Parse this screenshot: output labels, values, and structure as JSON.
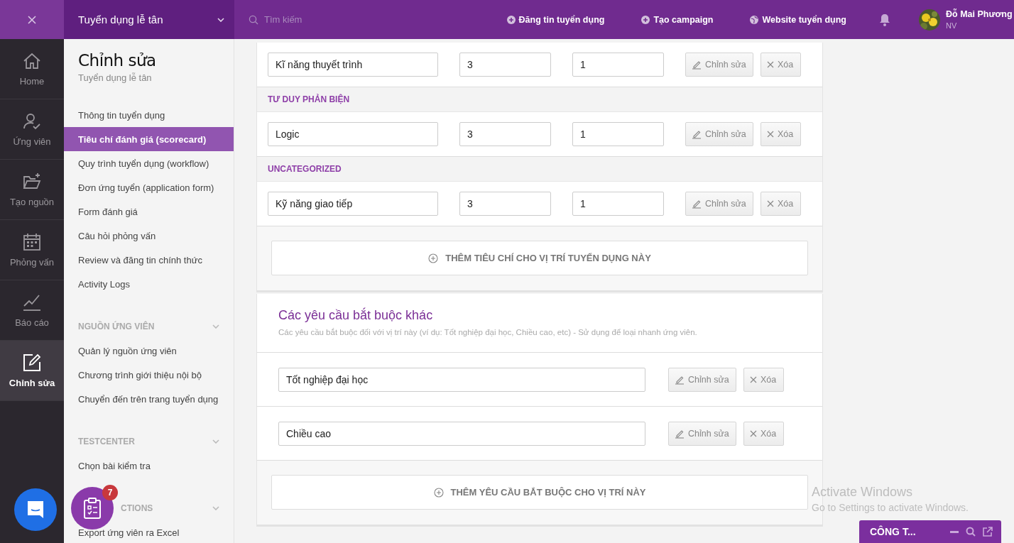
{
  "topbar": {
    "job_selector": "Tuyển dụng lễ tân",
    "search": {
      "placeholder": "Tìm kiếm"
    },
    "actions": [
      "Đăng tin tuyển dụng",
      "Tạo campaign",
      "Website tuyển dụng"
    ],
    "user": {
      "name": "Đỗ Mai Phương",
      "role": "NV"
    }
  },
  "rail": [
    {
      "label": "Home",
      "kind": "home",
      "selected": false
    },
    {
      "label": "Ứng viên",
      "kind": "candidate",
      "selected": false
    },
    {
      "label": "Tạo nguồn",
      "kind": "folder",
      "selected": false
    },
    {
      "label": "Phỏng vấn",
      "kind": "calendar",
      "selected": false
    },
    {
      "label": "Báo cáo",
      "kind": "chart",
      "selected": false
    },
    {
      "label": "Chỉnh sửa",
      "kind": "edit",
      "selected": true
    }
  ],
  "sidebar": {
    "title": "Chỉnh sửa",
    "subtitle": "Tuyển dụng lễ tân",
    "items": [
      {
        "label": "Thông tin tuyển dụng",
        "selected": false
      },
      {
        "label": "Tiêu chí đánh giá (scorecard)",
        "selected": true
      },
      {
        "label": "Quy trình tuyển dụng (workflow)",
        "selected": false
      },
      {
        "label": "Đơn ứng tuyển (application form)",
        "selected": false
      },
      {
        "label": "Form đánh giá",
        "selected": false
      },
      {
        "label": "Câu hỏi phỏng vấn",
        "selected": false
      },
      {
        "label": "Review và đăng tin chính thức",
        "selected": false
      },
      {
        "label": "Activity Logs",
        "selected": false
      }
    ],
    "sections": [
      {
        "heading": "NGUỒN ỨNG VIÊN",
        "items": [
          {
            "label": "Quản lý nguồn ứng viên",
            "selected": false
          },
          {
            "label": "Chương trình giới thiệu nội bộ",
            "selected": false
          },
          {
            "label": "Chuyển đến trên trang tuyển dụng",
            "selected": false
          }
        ]
      },
      {
        "heading": "TESTCENTER",
        "items": [
          {
            "label": "Chọn bài kiểm tra",
            "selected": false
          }
        ]
      },
      {
        "heading": "CTIONS",
        "items": [
          {
            "label": "Export ứng viên ra Excel",
            "selected": false
          }
        ]
      }
    ]
  },
  "criteria": {
    "items": [
      {
        "kind": "row",
        "name": "Kĩ năng thuyết trình",
        "score": "3",
        "weight": "1",
        "edit_label": "Chỉnh sửa",
        "delete_label": "Xóa"
      },
      {
        "kind": "heading",
        "label": "TƯ DUY PHẢN BIỆN"
      },
      {
        "kind": "row",
        "name": "Logic",
        "score": "3",
        "weight": "1",
        "edit_label": "Chỉnh sửa",
        "delete_label": "Xóa"
      },
      {
        "kind": "heading",
        "label": "UNCATEGORIZED"
      },
      {
        "kind": "row",
        "name": "Kỹ năng giao tiếp",
        "score": "3",
        "weight": "1",
        "edit_label": "Chỉnh sửa",
        "delete_label": "Xóa"
      }
    ],
    "add_button": "THÊM TIÊU CHÍ CHO VỊ TRÍ TUYỂN DỤNG NÀY"
  },
  "requirements": {
    "title": "Các yêu cầu bắt buộc khác",
    "description": "Các yêu cầu bắt buộc đối với vị trí này (ví dụ: Tốt nghiệp đại học, Chiều cao, etc) - Sử dụng để loại nhanh ứng viên.",
    "items": [
      {
        "name": "Tốt nghiệp đại học",
        "edit_label": "Chỉnh sửa",
        "delete_label": "Xóa"
      },
      {
        "name": "Chiều cao",
        "edit_label": "Chỉnh sửa",
        "delete_label": "Xóa"
      }
    ],
    "add_button": "THÊM YÊU CẦU BẮT BUỘC CHO VỊ TRÍ NÀY"
  },
  "fab": {
    "badge": "7"
  },
  "chat_bar": {
    "title": "CÔNG T..."
  },
  "os_notice": {
    "title": "Activate Windows",
    "text": "Go to Settings to activate Windows."
  }
}
